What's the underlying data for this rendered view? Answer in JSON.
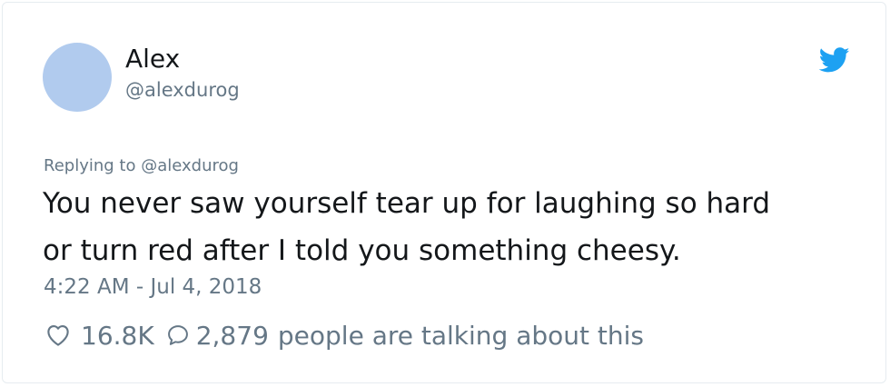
{
  "author": {
    "display_name": "Alex",
    "handle": "@alexdurog",
    "avatar_color": "#b1cbee"
  },
  "brand": {
    "icon": "twitter-bird-icon",
    "color": "#1da1f2"
  },
  "reply": {
    "prefix": "Replying to",
    "mention": "@alexdurog"
  },
  "tweet": {
    "text_lines": [
      "You never saw yourself tear up for laughing so hard",
      "or turn red after I told you something cheesy."
    ],
    "timestamp": "4:22 AM - Jul 4, 2018"
  },
  "stats": {
    "likes": "16.8K",
    "replies": "2,879",
    "talking_text": "people are talking about this",
    "like_icon": "heart-icon",
    "reply_icon": "speech-bubble-icon"
  },
  "colors": {
    "text_primary": "#14171a",
    "text_secondary": "#657786",
    "border": "#e6ecf0"
  }
}
